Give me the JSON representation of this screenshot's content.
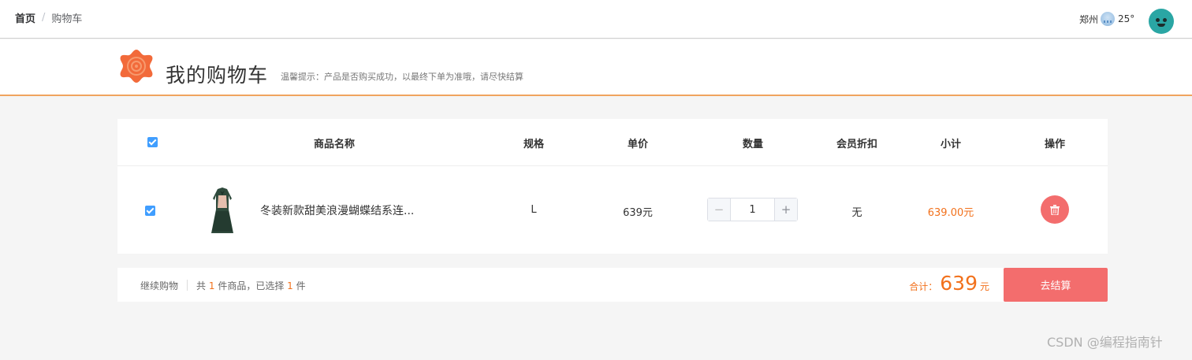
{
  "topbar": {
    "breadcrumb_home": "首页",
    "breadcrumb_sep": "/",
    "breadcrumb_current": "购物车",
    "city": "郑州",
    "weather_icon": "cloud-rain-icon",
    "temperature": "25°"
  },
  "header": {
    "title": "我的购物车",
    "tip": "温馨提示：产品是否购买成功，以最终下单为准哦，请尽快结算"
  },
  "table": {
    "select_all_checked": true,
    "columns": [
      "商品名称",
      "规格",
      "单价",
      "数量",
      "会员折扣",
      "小计",
      "操作"
    ],
    "items": [
      {
        "checked": true,
        "name": "冬装新款甜美浪漫蝴蝶结系连...",
        "spec": "L",
        "price": "639元",
        "quantity": "1",
        "discount": "无",
        "subtotal": "639.00元"
      }
    ]
  },
  "footer": {
    "continue_label": "继续购物",
    "count_prefix": "共",
    "count_total": "1",
    "count_mid": "件商品，已选择",
    "count_selected": "1",
    "count_suffix": "件",
    "total_label": "合计：",
    "total_amount": "639",
    "total_unit": "元",
    "checkout_label": "去结算"
  },
  "colors": {
    "accent": "#f2711c",
    "danger": "#f36d6d",
    "checkbox": "#409eff",
    "header_border": "#f0a35e"
  },
  "watermark": "CSDN @编程指南针"
}
